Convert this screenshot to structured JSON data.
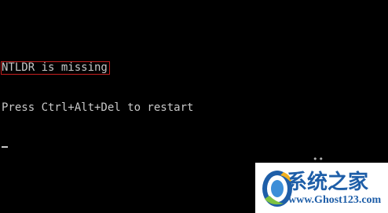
{
  "console": {
    "error_message": "NTLDR is missing",
    "restart_prompt": "Press Ctrl+Alt+Del to restart"
  },
  "colors": {
    "background": "#000000",
    "console_text": "#c8c8c8",
    "highlight_border": "#c62020",
    "watermark_blue": "#1e5ea8"
  },
  "watermark": {
    "site_name": "系统之家",
    "url": "www.Ghost123.com",
    "logo_icon": "ghost123-logo-icon"
  },
  "decor": {
    "dots": "••"
  }
}
